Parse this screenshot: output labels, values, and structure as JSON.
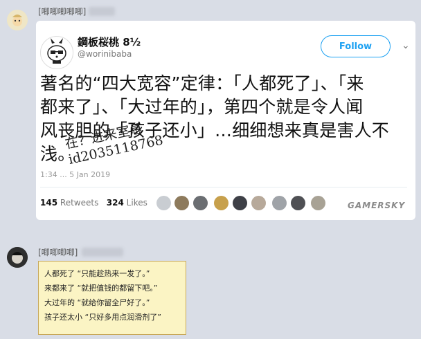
{
  "chat": {
    "sender_1_name": "[唧唧唧唧唧]",
    "sender_2_name": "[唧唧唧唧]"
  },
  "tweet": {
    "display_name": "鋼板桜桃 8½",
    "handle": "@worinibaba",
    "follow_label": "Follow",
    "text_lines": [
      "著名的“四大宽容”定律：「人都死了」、「来",
      "都来了」、「大过年的」，第四个就是令人闻",
      "风丧胆的「孩子还小」…细细想来真是害人不",
      "浅。"
    ],
    "handwritten_lines": [
      "在？进来室息",
      "id2035118768"
    ],
    "timestamp": "1:34 ... 5 Jan 2019",
    "retweets_count": "145",
    "retweets_label": "Retweets",
    "likes_count": "324",
    "likes_label": "Likes",
    "watermark": "GAMERSKY"
  },
  "reply_note": {
    "lines": [
      "人都死了 “只能趁热来一发了。”",
      "来都来了 “就把值钱的都留下吧。”",
      "大过年的 “就给你留全尸好了。”",
      "孩子还太小 “只好多用点润滑剂了”"
    ]
  }
}
